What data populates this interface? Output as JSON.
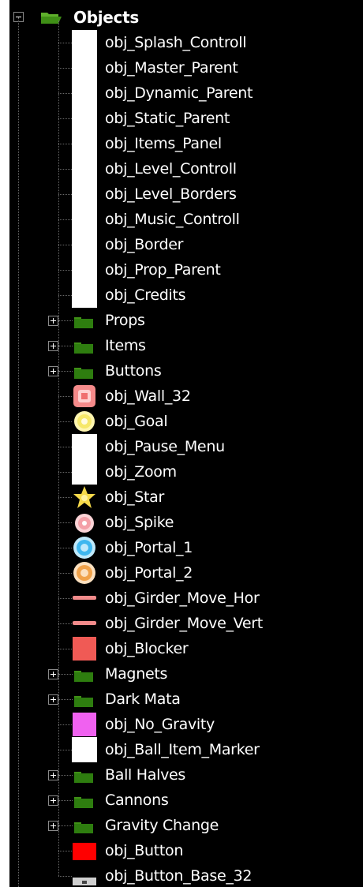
{
  "root": {
    "label": "Objects",
    "expander": "minus",
    "icon": "open-folder-icon",
    "folder_color": "#2e7d0f"
  },
  "items": [
    {
      "type": "object",
      "label": "obj_Splash_Controll",
      "sprite": "white-blank-sprite-icon",
      "color": "#ffffff"
    },
    {
      "type": "object",
      "label": "obj_Master_Parent",
      "sprite": "white-blank-sprite-icon",
      "color": "#ffffff"
    },
    {
      "type": "object",
      "label": "obj_Dynamic_Parent",
      "sprite": "white-blank-sprite-icon",
      "color": "#ffffff"
    },
    {
      "type": "object",
      "label": "obj_Static_Parent",
      "sprite": "white-blank-sprite-icon",
      "color": "#ffffff"
    },
    {
      "type": "object",
      "label": "obj_Items_Panel",
      "sprite": "white-blank-sprite-icon",
      "color": "#ffffff"
    },
    {
      "type": "object",
      "label": "obj_Level_Controll",
      "sprite": "white-blank-sprite-icon",
      "color": "#ffffff"
    },
    {
      "type": "object",
      "label": "obj_Level_Borders",
      "sprite": "white-blank-sprite-icon",
      "color": "#ffffff"
    },
    {
      "type": "object",
      "label": "obj_Music_Controll",
      "sprite": "white-blank-sprite-icon",
      "color": "#ffffff"
    },
    {
      "type": "object",
      "label": "obj_Border",
      "sprite": "white-blank-sprite-icon",
      "color": "#ffffff"
    },
    {
      "type": "object",
      "label": "obj_Prop_Parent",
      "sprite": "white-blank-sprite-icon",
      "color": "#ffffff"
    },
    {
      "type": "object",
      "label": "obj_Credits",
      "sprite": "white-blank-sprite-icon",
      "color": "#ffffff"
    },
    {
      "type": "folder",
      "label": "Props",
      "expander": "plus",
      "icon": "folder-icon"
    },
    {
      "type": "folder",
      "label": "Items",
      "expander": "plus",
      "icon": "folder-icon"
    },
    {
      "type": "folder",
      "label": "Buttons",
      "expander": "plus",
      "icon": "folder-icon"
    },
    {
      "type": "object",
      "label": "obj_Wall_32",
      "sprite": "wall-sprite-icon",
      "color": "#f58a8a"
    },
    {
      "type": "object",
      "label": "obj_Goal",
      "sprite": "goal-sprite-icon",
      "color": "#f6e86a"
    },
    {
      "type": "object",
      "label": "obj_Pause_Menu",
      "sprite": "white-blank-sprite-icon",
      "color": "#ffffff"
    },
    {
      "type": "object",
      "label": "obj_Zoom",
      "sprite": "white-blank-sprite-icon",
      "color": "#ffffff"
    },
    {
      "type": "object",
      "label": "obj_Star",
      "sprite": "star-sprite-icon",
      "color": "#f5d94a"
    },
    {
      "type": "object",
      "label": "obj_Spike",
      "sprite": "spike-sprite-icon",
      "color": "#f4a0a8"
    },
    {
      "type": "object",
      "label": "obj_Portal_1",
      "sprite": "portal-blue-sprite-icon",
      "color": "#3fb7ef"
    },
    {
      "type": "object",
      "label": "obj_Portal_2",
      "sprite": "portal-orange-sprite-icon",
      "color": "#f0a24a"
    },
    {
      "type": "object",
      "label": "obj_Girder_Move_Hor",
      "sprite": "girder-sprite-icon",
      "color": "#f28b8b"
    },
    {
      "type": "object",
      "label": "obj_Girder_Move_Vert",
      "sprite": "girder-sprite-icon",
      "color": "#f28b8b"
    },
    {
      "type": "object",
      "label": "obj_Blocker",
      "sprite": "blocker-sprite-icon",
      "color": "#f05a55"
    },
    {
      "type": "folder",
      "label": "Magnets",
      "expander": "plus",
      "icon": "folder-icon"
    },
    {
      "type": "folder",
      "label": "Dark Mata",
      "expander": "plus",
      "icon": "folder-icon"
    },
    {
      "type": "object",
      "label": "obj_No_Gravity",
      "sprite": "no-gravity-sprite-icon",
      "color": "#f061f0"
    },
    {
      "type": "object",
      "label": "obj_Ball_Item_Marker",
      "sprite": "white-blank-sprite-icon",
      "color": "#ffffff"
    },
    {
      "type": "folder",
      "label": "Ball Halves",
      "expander": "plus",
      "icon": "folder-icon"
    },
    {
      "type": "folder",
      "label": "Cannons",
      "expander": "plus",
      "icon": "folder-icon"
    },
    {
      "type": "folder",
      "label": "Gravity Change",
      "expander": "plus",
      "icon": "folder-icon"
    },
    {
      "type": "object",
      "label": "obj_Button",
      "sprite": "button-sprite-icon",
      "color": "#ff0000"
    },
    {
      "type": "object",
      "label": "obj_Button_Base_32",
      "sprite": "button-base-sprite-icon",
      "color": "#cfcfcf"
    }
  ]
}
